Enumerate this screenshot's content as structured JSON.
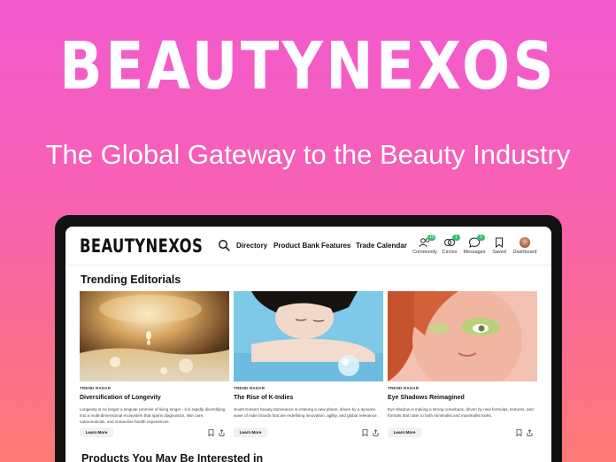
{
  "hero": {
    "title": "BEAUTYNEXOS",
    "subtitle": "The Global Gateway to the Beauty Industry"
  },
  "app": {
    "logo": "BEAUTYNEXOS",
    "search_icon": "search-icon",
    "nav": [
      "Directory",
      "Product Bank",
      "Features",
      "Trade Calendar"
    ],
    "utilities": [
      {
        "label": "Community",
        "icon": "community-icon",
        "badge": "15"
      },
      {
        "label": "Circles",
        "icon": "circles-icon",
        "badge": "1"
      },
      {
        "label": "Messages",
        "icon": "messages-icon",
        "badge": "1"
      },
      {
        "label": "Saved",
        "icon": "bookmark-icon",
        "badge": ""
      },
      {
        "label": "Dashboard",
        "icon": "avatar",
        "badge": ""
      }
    ],
    "accent_color": "#2fbf71"
  },
  "trending": {
    "title": "Trending Editorials",
    "cards": [
      {
        "kicker": "TREND RADAR",
        "title": "Diversification of Longevity",
        "description": "Longevity is no longer a singular promise of living longer - it is rapidly diversifying into a multi-dimensional ecosystem that spans diagnostics, skin care, nutraceuticals, and immersive health experiences.",
        "button": "Learn More",
        "image": "golden serum droplet photo"
      },
      {
        "kicker": "TREND RADAR",
        "title": "The Rise of K-Indies",
        "description": "South Korea's beauty dominance is entering a new phase, driven by a dynamic wave of indie brands that are redefining innovation, agility, and global relevance.",
        "button": "Learn More",
        "image": "woman with glass sphere photo"
      },
      {
        "kicker": "TREND RADAR",
        "title": "Eye Shadows Reimagined",
        "description": "Eye shadow is making a strong comeback, driven by new formulas, textures, and formats that cater to both minimalist and maximalist looks.",
        "button": "Learn More",
        "image": "green eye shadow portrait photo"
      }
    ]
  },
  "products": {
    "title": "Products You May Be Interested in"
  }
}
